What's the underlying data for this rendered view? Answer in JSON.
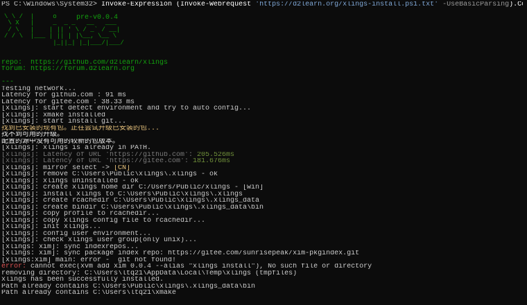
{
  "prompt": {
    "path": "PS C:\\Windows\\System32> ",
    "command": "Invoke-Expression (Invoke-Webrequest ",
    "url": "'https://d2learn.org/xlings-install.ps1.txt'",
    "flag": " -UseBasicParsing",
    "suffix": ").Content"
  },
  "logo": {
    "art": "\\ \\ /  |     o                 \n \\ X   |     _  _ _   __   ___\n / \\   |    | || ' \\ / _` / __|\n/ / \\  |___ | || | |\\__, \\__ \\\n             |_||_| |_|___/|___/",
    "version": "pre-v0.0.4"
  },
  "info": {
    "repo": "repo:  https://github.com/d2learn/xlings",
    "forum": "forum: https://forum.d2learn.org",
    "separator": "---"
  },
  "lines": [
    {
      "text": "Testing network...",
      "tone": "default"
    },
    {
      "text": "Latency for github.com : 91 ms",
      "tone": "default"
    },
    {
      "text": "Latency for gitee.com : 38.33 ms",
      "tone": "default"
    },
    {
      "text": "[xlings]: start detect environment and try to auto config...",
      "tone": "default"
    },
    {
      "text": "[xlings]: xmake installed",
      "tone": "default"
    },
    {
      "text": "[xlings]: start install git...",
      "tone": "default"
    },
    {
      "text": "找到已安装的现有包。正在尝试升级已安装的包...",
      "tone": "yellow"
    },
    {
      "text": "找不到可用的升级。",
      "tone": "white"
    },
    {
      "text": "配置的源中没有可用的较新的包版本。",
      "tone": "white"
    },
    {
      "text": "[xlings]: xlings is already in PATH.",
      "tone": "default"
    },
    {
      "text": "[xlings]: Latency of URL 'https://github.com': 205.526ms",
      "tone": "gray"
    },
    {
      "text": "[xlings]: Latency of URL 'https://gitee.com': 181.676ms",
      "tone": "gray"
    },
    {
      "text": "[xlings]: mirror select -> [CN]",
      "tone": "default"
    },
    {
      "text": "[xlings]: remove C:\\Users\\Public\\xlings\\.xlings - ok",
      "tone": "default"
    },
    {
      "text": "[xlings]: xlings uninstalled - ok",
      "tone": "default"
    },
    {
      "text": "[xlings]: create xlings home dir C:/Users/Public/xlings - [win]",
      "tone": "default"
    },
    {
      "text": "[xlings]: install xlings to C:\\Users\\Public\\xlings\\.xlings",
      "tone": "default"
    },
    {
      "text": "[xlings]: create rcachedir C:\\Users\\Public\\xlings\\.xlings_data",
      "tone": "default"
    },
    {
      "text": "[xlings]: create bindir C:\\Users\\Public\\xlings\\.xlings_data\\bin",
      "tone": "default"
    },
    {
      "text": "[xlings]: copy profile to rcachedir...",
      "tone": "default"
    },
    {
      "text": "[xlings]: copy xlings config file to rcachedir...",
      "tone": "default"
    },
    {
      "text": "[xlings]: init xlings...",
      "tone": "default"
    },
    {
      "text": "[xlings]: config user environment...",
      "tone": "default"
    },
    {
      "text": "[xlings]: check xlings user group(only unix)...",
      "tone": "default"
    },
    {
      "text": "[xlings: xim]: sync indexrepos...",
      "tone": "default"
    },
    {
      "text": "[xlings: xim]: sync package index repo: https://gitee.com/sunrisepeak/xim-pkgindex.git",
      "tone": "default"
    },
    {
      "text": "[xlings:xim] main: error -  git not found!",
      "tone": "default"
    },
    {
      "text": "error: cannot exec(xvm add xim 0.0.4 --alias \"xlings install\"), No such file or directory",
      "tone": "default"
    },
    {
      "text": "removing directory: C:\\Users\\ltq21\\AppData\\Local\\Temp\\xlings (tmpfiles)",
      "tone": "default"
    },
    {
      "text": "xlings has been successfully installed.",
      "tone": "default"
    },
    {
      "text": "Path already contains C:\\Users\\Public\\xlings\\.xlings_data\\bin",
      "tone": "default"
    },
    {
      "text": "Path already contains C:\\Users\\ltq21\\xmake",
      "tone": "default"
    }
  ],
  "colors": {
    "background": "#0c0c0c",
    "text": "#cccccc",
    "green": "#13a10e",
    "yellow": "#e5c07b",
    "error": "#e05252"
  }
}
